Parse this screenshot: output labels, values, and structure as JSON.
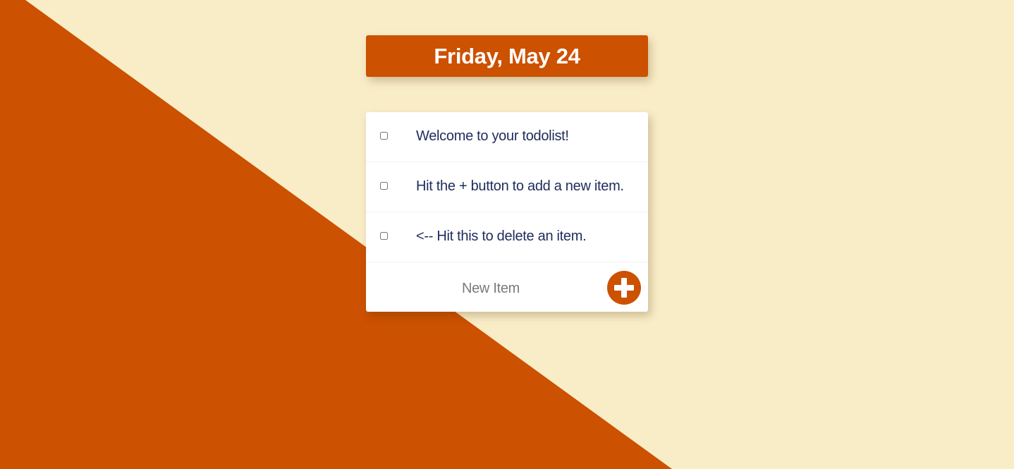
{
  "header": {
    "date_title": "Friday, May 24"
  },
  "todo": {
    "items": [
      {
        "text": "Welcome to your todolist!",
        "checked": false
      },
      {
        "text": "Hit the + button to add a new item.",
        "checked": false
      },
      {
        "text": "<-- Hit this to delete an item.",
        "checked": false
      }
    ],
    "new_item": {
      "placeholder": "New Item",
      "value": "",
      "add_icon": "plus-icon"
    }
  },
  "colors": {
    "accent": "#cc5100",
    "background": "#f9edc7",
    "card": "#ffffff",
    "item_text": "#1f2c5b"
  }
}
